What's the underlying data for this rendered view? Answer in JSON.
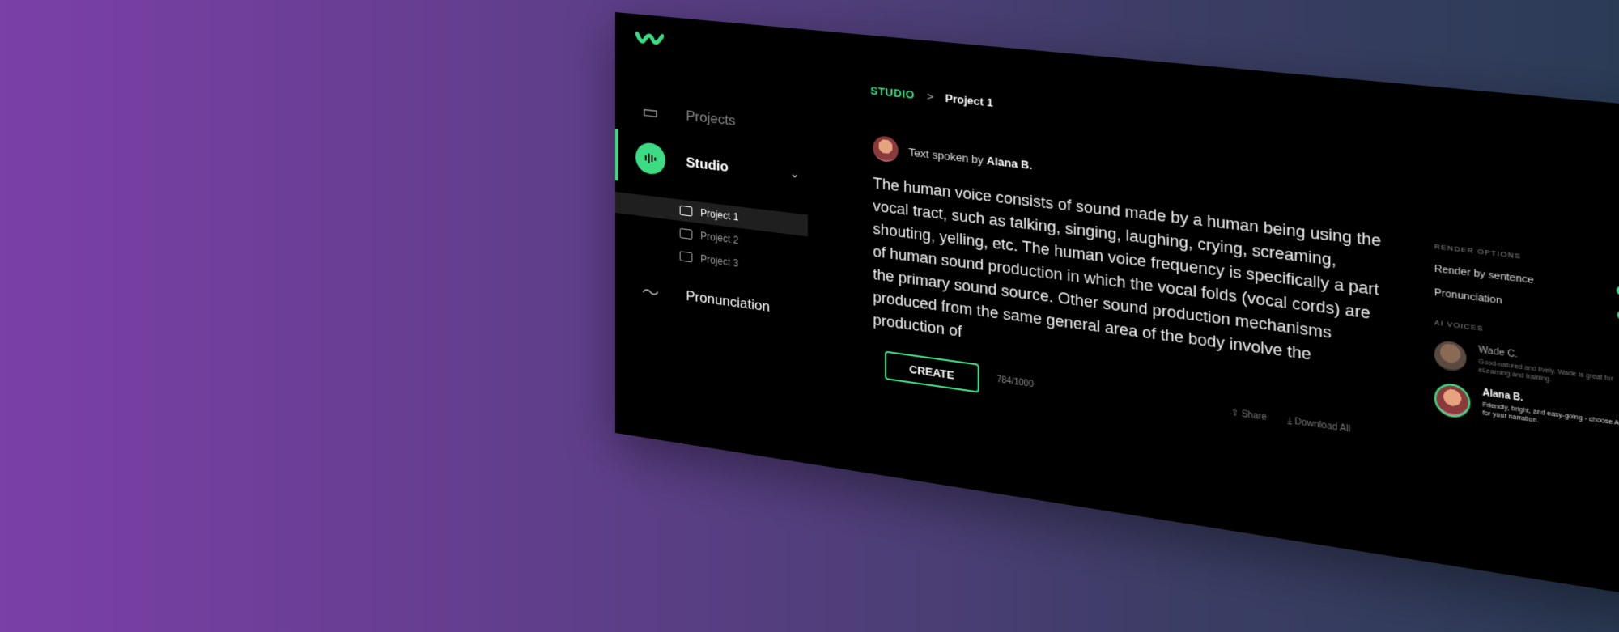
{
  "colors": {
    "accent": "#3ddc84",
    "window_bg": "#000000"
  },
  "sidebar": {
    "logo_icon": "wave-logo-icon",
    "items": [
      {
        "label": "Projects",
        "icon": "folder-icon"
      },
      {
        "label": "Studio",
        "icon": "waveform-icon"
      },
      {
        "label": "Pronunciation",
        "icon": "tilde-icon"
      }
    ],
    "projects": [
      "Project 1",
      "Project 2",
      "Project 3"
    ]
  },
  "breadcrumb": {
    "root": "STUDIO",
    "current": "Project 1"
  },
  "speaker": {
    "prefix": "Text spoken by",
    "name": "Alana B."
  },
  "editor": {
    "text": "The human voice consists of sound made by a human being using the vocal tract, such as talking, singing, laughing, crying, screaming, shouting, yelling, etc. The human voice frequency is specifically a part of human sound production in which the vocal folds (vocal cords) are the primary sound source. Other sound production mechanisms produced from the same general area of the body involve the production of",
    "create_label": "CREATE",
    "counter": "784/1000",
    "share_label": "Share",
    "download_label": "Download All"
  },
  "render_options": {
    "heading": "RENDER OPTIONS",
    "render_by_sentence": "Render by sentence",
    "render_by_sentence_on": true,
    "pronunciation": "Pronunciation",
    "pronunciation_on": false
  },
  "ai_voices": {
    "heading": "AI VOICES",
    "voices": [
      {
        "name": "Wade C.",
        "desc": "Good-natured and lively. Wade is great for eLearning and training."
      },
      {
        "name": "Alana B.",
        "desc": "Friendly, bright, and easy-going - choose Alana for your narration."
      }
    ]
  }
}
